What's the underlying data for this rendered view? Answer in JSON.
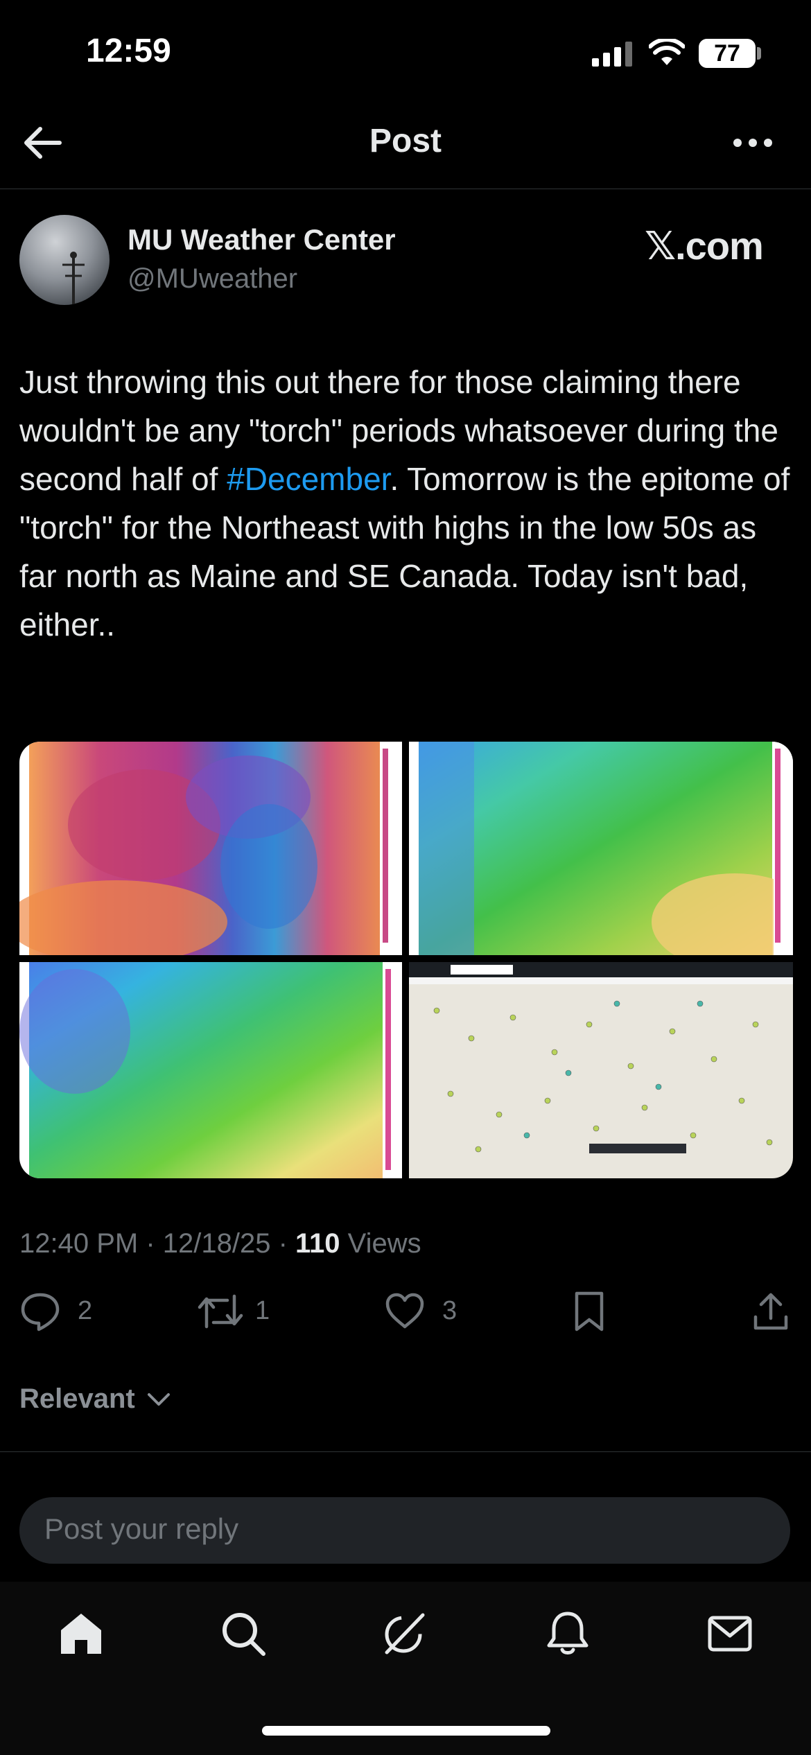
{
  "status_bar": {
    "time": "12:59",
    "battery": "77"
  },
  "header": {
    "title": "Post"
  },
  "author": {
    "name": "MU Weather Center",
    "handle": "@MUweather",
    "source": "𝕏.com"
  },
  "post": {
    "text_before": "Just throwing this out there for those claiming there wouldn't be any \"torch\" periods whatsoever during the second half of ",
    "hashtag": "#December",
    "text_after": ". Tomorrow is the epitome of \"torch\" for the Northeast with highs in the low 50s as far north as Maine and SE Canada. Today isn't bad, either..",
    "time": "12:40 PM",
    "date": "12/18/25",
    "views_count": "110",
    "views_label": "Views"
  },
  "actions": {
    "replies": "2",
    "reposts": "1",
    "likes": "3"
  },
  "sort": {
    "label": "Relevant"
  },
  "reply": {
    "placeholder": "Post your reply"
  },
  "icons": [
    "back-arrow-icon",
    "more-icon",
    "reply-icon",
    "repost-icon",
    "like-icon",
    "bookmark-icon",
    "share-icon",
    "chevron-down-icon",
    "home-icon",
    "search-icon",
    "grok-icon",
    "notifications-icon",
    "messages-icon"
  ],
  "colors": {
    "accent": "#1d9bf0",
    "muted": "#71767b",
    "text": "#e7e9ea"
  }
}
